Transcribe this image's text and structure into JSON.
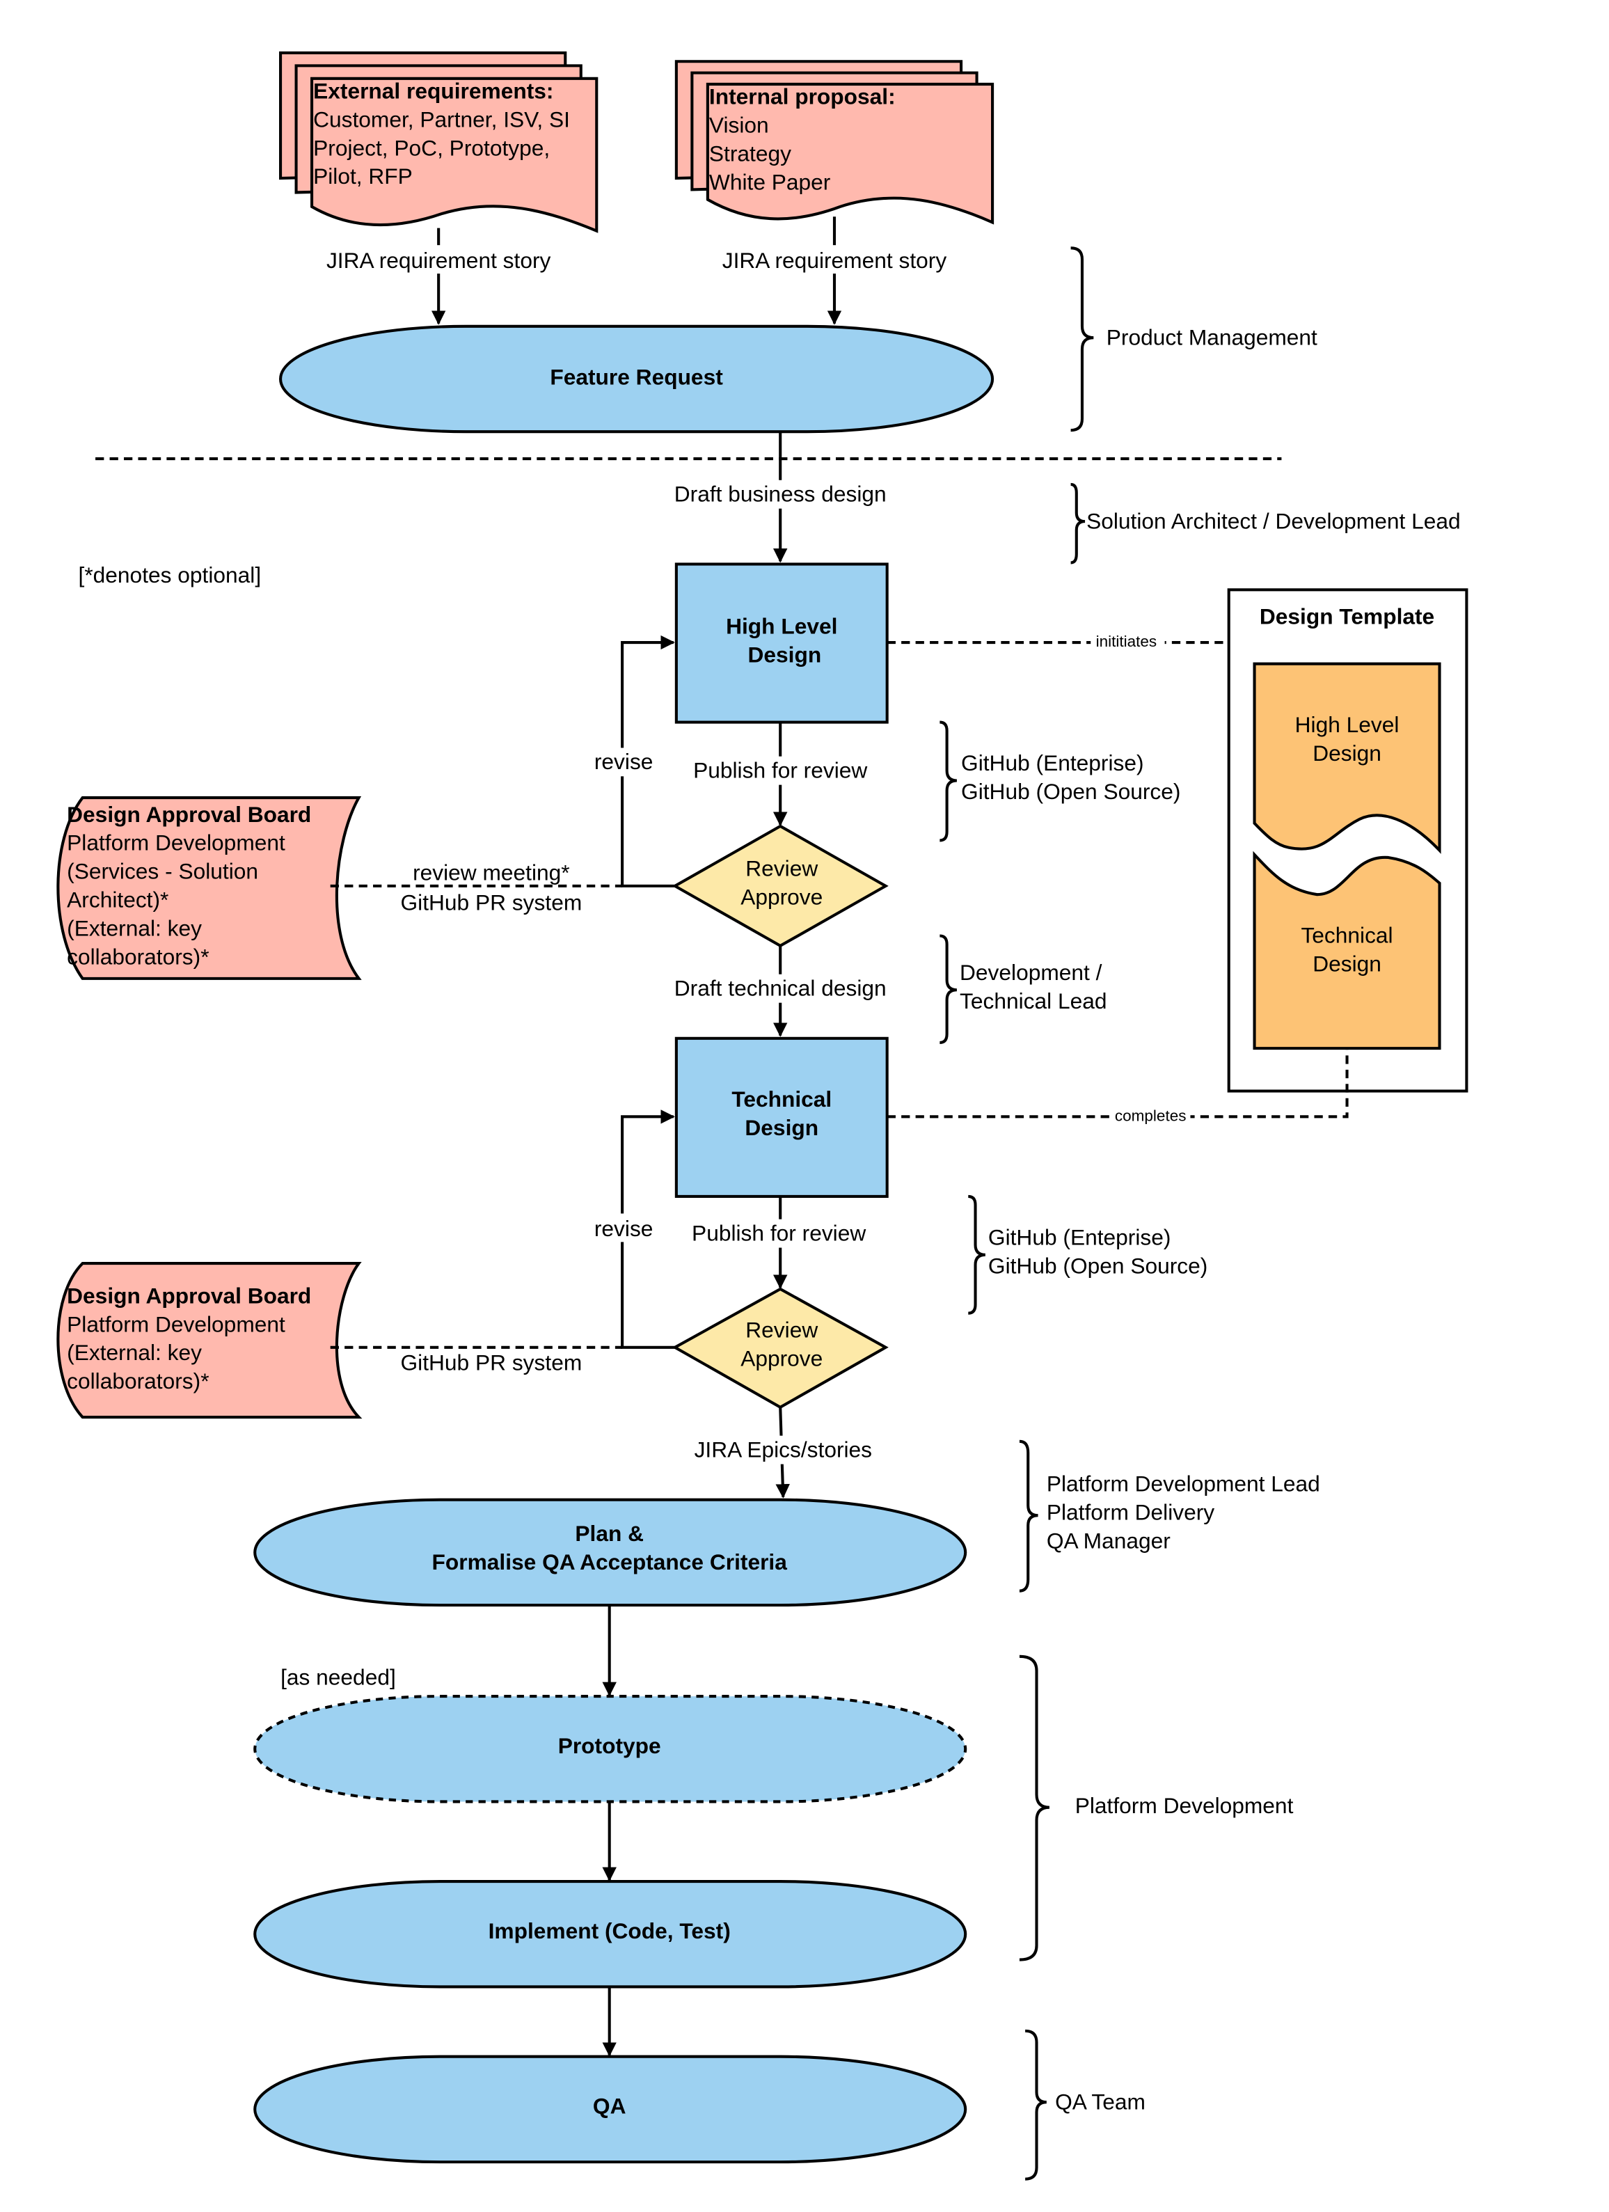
{
  "colors": {
    "process": "#9dd1f1",
    "document": "#ffb9ae",
    "decision": "#fde9a8",
    "template": "#fdc375"
  },
  "external_requirements": {
    "title": "External requirements:",
    "lines": [
      "Customer, Partner, ISV, SI",
      "Project, PoC, Prototype,",
      "Pilot, RFP"
    ],
    "edge_label": "JIRA requirement story"
  },
  "internal_proposal": {
    "title": "Internal proposal:",
    "lines": [
      "Vision",
      "Strategy",
      "White Paper"
    ],
    "edge_label": "JIRA requirement story"
  },
  "feature_request": "Feature Request",
  "roles": {
    "product_management": "Product Management",
    "solution_architect": "Solution Architect / Development Lead",
    "github_1": [
      "GitHub (Enteprise)",
      "GitHub (Open Source)"
    ],
    "dev_lead": [
      "Development /",
      "Technical Lead"
    ],
    "github_2": [
      "GitHub (Enteprise)",
      "GitHub (Open Source)"
    ],
    "platform_leads": [
      "Platform Development Lead",
      "Platform Delivery",
      "QA Manager"
    ],
    "platform_development": "Platform Development",
    "qa_team": "QA Team"
  },
  "note_optional": "[*denotes optional]",
  "edges": {
    "draft_business_design": "Draft business design",
    "publish_review_1": "Publish for review",
    "revise_1": "revise",
    "review_meeting": "review meeting*",
    "github_pr_1": "GitHub PR system",
    "draft_technical_design": "Draft technical design",
    "publish_review_2": "Publish for review",
    "revise_2": "revise",
    "github_pr_2": "GitHub PR system",
    "jira_epics": "JIRA Epics/stories",
    "as_needed": "[as needed]",
    "initiates": "inititiates",
    "completes": "completes"
  },
  "high_level_design": [
    "High Level",
    "Design"
  ],
  "technical_design": [
    "Technical",
    "Design"
  ],
  "review_approve_1": [
    "Review",
    "Approve"
  ],
  "review_approve_2": [
    "Review",
    "Approve"
  ],
  "dab_1": {
    "title": "Design Approval Board",
    "lines": [
      "Platform Development",
      "(Services - Solution",
      "Architect)*",
      "(External: key",
      "collaborators)*"
    ]
  },
  "dab_2": {
    "title": "Design Approval Board",
    "lines": [
      "Platform Development",
      "(External: key",
      "collaborators)*"
    ]
  },
  "design_template": {
    "title": "Design Template",
    "hld": [
      "High Level",
      "Design"
    ],
    "td": [
      "Technical",
      "Design"
    ]
  },
  "plan": [
    "Plan &",
    "Formalise QA Acceptance Criteria"
  ],
  "prototype": "Prototype",
  "implement": "Implement (Code, Test)",
  "qa": "QA"
}
